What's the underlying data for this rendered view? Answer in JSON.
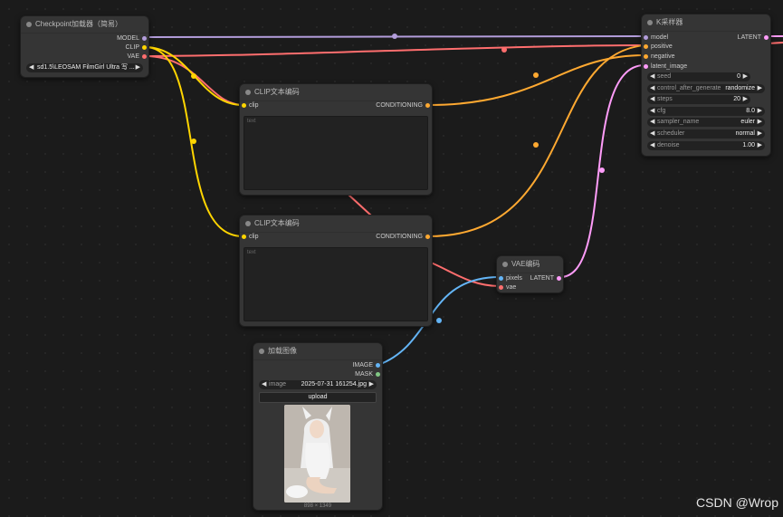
{
  "nodes": {
    "checkpoint": {
      "title": "Checkpoint加载器（简易）",
      "outputs": [
        "MODEL",
        "CLIP",
        "VAE"
      ],
      "ckpt_value": "sd1.5\\LEOSAM FilmGirl Ultra 写 ..."
    },
    "clip1": {
      "title": "CLIP文本编码",
      "input": "clip",
      "output": "CONDITIONING",
      "text_placeholder": "text"
    },
    "clip2": {
      "title": "CLIP文本编码",
      "input": "clip",
      "output": "CONDITIONING",
      "text_placeholder": "text"
    },
    "ksampler": {
      "title": "K采样器",
      "inputs": [
        "model",
        "positive",
        "negative",
        "latent_image"
      ],
      "output": "LATENT",
      "widgets": [
        {
          "label": "seed",
          "value": "0"
        },
        {
          "label": "control_after_generate",
          "value": "randomize"
        },
        {
          "label": "steps",
          "value": "20"
        },
        {
          "label": "cfg",
          "value": "8.0"
        },
        {
          "label": "sampler_name",
          "value": "euler"
        },
        {
          "label": "scheduler",
          "value": "normal"
        },
        {
          "label": "denoise",
          "value": "1.00"
        }
      ]
    },
    "vae_encode": {
      "title": "VAE编码",
      "inputs": [
        "pixels",
        "vae"
      ],
      "output": "LATENT"
    },
    "load_image": {
      "title": "加载图像",
      "outputs": [
        "IMAGE",
        "MASK"
      ],
      "image_label": "image",
      "image_value": "2025-07-31 161254.jpg",
      "upload_label": "upload",
      "dimensions": "898 × 1349"
    }
  },
  "colors": {
    "model": "#b39ddb",
    "clip": "#ffd500",
    "vae": "#ff6e6e",
    "conditioning": "#ffa931",
    "latent": "#ff9cf9",
    "image": "#64b5f6",
    "mask": "#81c784"
  },
  "watermark": "CSDN @Wrop"
}
